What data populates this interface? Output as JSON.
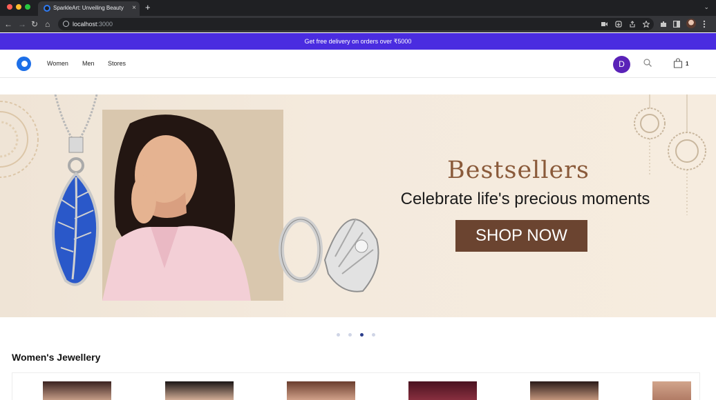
{
  "browser": {
    "tab_title": "SparkleArt: Unveiling Beauty -",
    "tab_close": "×",
    "new_tab": "+",
    "tab_menu": "⌄",
    "url_host": "localhost",
    "url_port": ":3000",
    "nav": {
      "back": "←",
      "forward": "→",
      "reload": "↻",
      "home": "⌂"
    }
  },
  "promo": {
    "text": "Get free delivery on orders over ₹5000"
  },
  "header": {
    "nav": [
      "Women",
      "Men",
      "Stores"
    ],
    "avatar_initial": "D",
    "cart_count": "1"
  },
  "hero": {
    "title": "Bestsellers",
    "subtitle": "Celebrate life's precious moments",
    "cta": "SHOP NOW",
    "slides": 4,
    "active_slide": 3
  },
  "section": {
    "title": "Women's Jewellery"
  },
  "colors": {
    "brand": "#4a2ce0",
    "avatar": "#5a22b8",
    "cta": "#6b4430",
    "title": "#8a5a3a"
  },
  "icons": [
    "search-icon",
    "bag-icon",
    "logo-icon",
    "lock-icon"
  ]
}
